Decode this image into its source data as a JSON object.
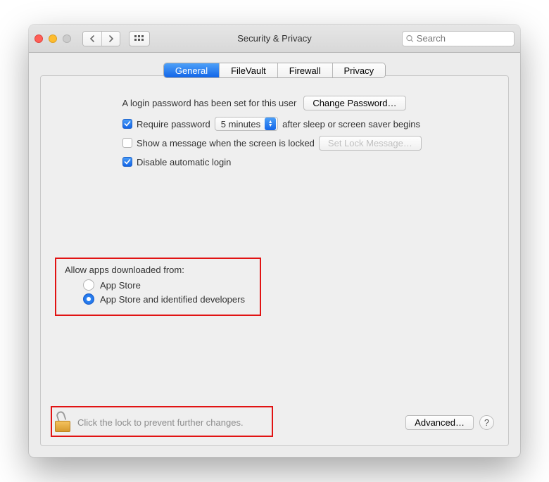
{
  "window": {
    "title": "Security & Privacy"
  },
  "search": {
    "placeholder": "Search"
  },
  "tabs": {
    "general": "General",
    "filevault": "FileVault",
    "firewall": "Firewall",
    "privacy": "Privacy"
  },
  "login": {
    "text": "A login password has been set for this user",
    "change_btn": "Change Password…",
    "require_label": "Require password",
    "delay_value": "5 minutes",
    "after_text": "after sleep or screen saver begins",
    "show_message_label": "Show a message when the screen is locked",
    "set_message_btn": "Set Lock Message…",
    "disable_auto_label": "Disable automatic login"
  },
  "allow": {
    "heading": "Allow apps downloaded from:",
    "opt1": "App Store",
    "opt2": "App Store and identified developers"
  },
  "footer": {
    "lock_text": "Click the lock to prevent further changes.",
    "advanced_btn": "Advanced…"
  }
}
